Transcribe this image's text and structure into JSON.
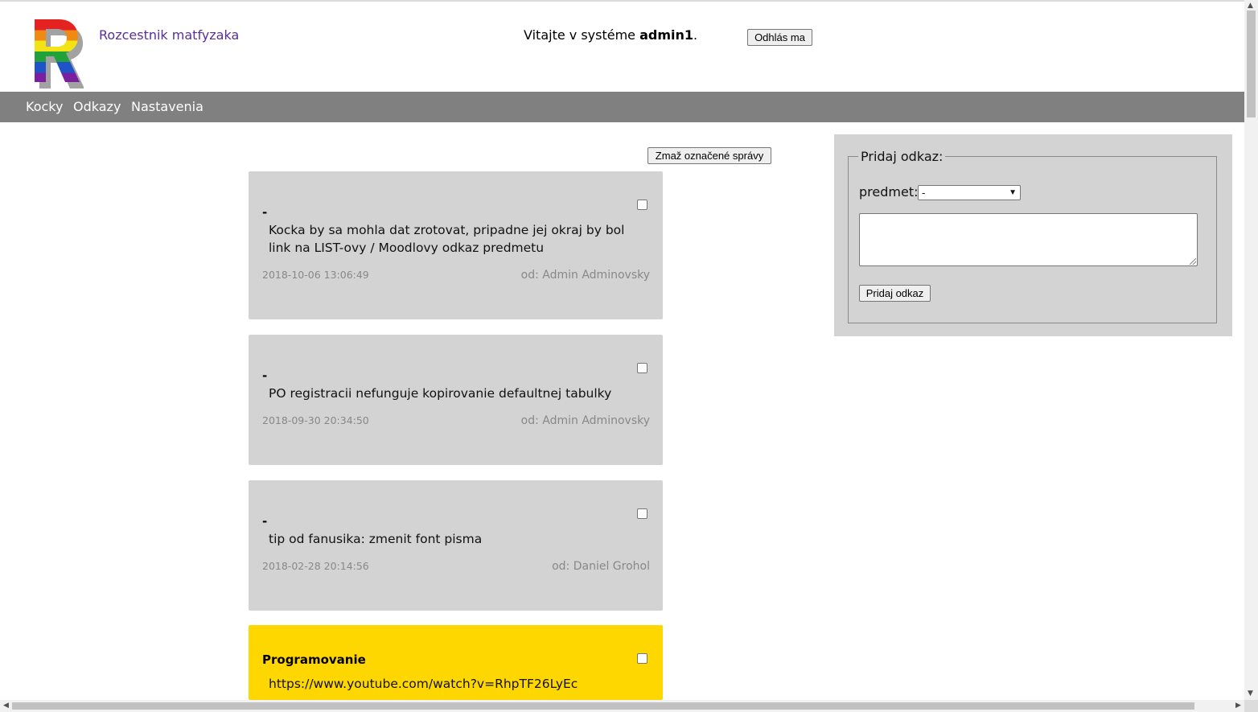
{
  "header": {
    "site_name": "Rozcestnik matfyzaka",
    "welcome_prefix": "Vitajte v systéme ",
    "username": "admin1",
    "welcome_suffix": ".",
    "logout_label": "Odhlás ma",
    "logo_letter": "R"
  },
  "nav": {
    "items": [
      {
        "label": "Kocky"
      },
      {
        "label": "Odkazy"
      },
      {
        "label": "Nastavenia"
      }
    ]
  },
  "main": {
    "delete_label": "Zmaž označené správy",
    "messages": [
      {
        "title": "-",
        "text": "Kocka by sa mohla dat zrotovat, pripadne jej okraj by bol link na LIST-ovy / Moodlovy odkaz predmetu",
        "date": "2018-10-06 13:06:49",
        "author": "od: Admin Adminovsky",
        "checked": false
      },
      {
        "title": "-",
        "text": "PO registracii nefunguje kopirovanie defaultnej tabulky",
        "date": "2018-09-30 20:34:50",
        "author": "od: Admin Adminovsky",
        "checked": false
      },
      {
        "title": "-",
        "text": "tip od fanusika: zmenit font pisma",
        "date": "2018-02-28 20:14:56",
        "author": "od: Daniel Grohol",
        "checked": false
      },
      {
        "title": "Programovanie",
        "text": "https://www.youtube.com/watch?v=RhpTF26LyEc",
        "checked": false,
        "color": "#ffd700"
      }
    ]
  },
  "side": {
    "legend": "Pridaj odkaz:",
    "subject_label": "predmet:",
    "subject_selected": "-",
    "link_value": "",
    "add_label": "Pridaj odkaz"
  },
  "colors": {
    "nav_bg": "#808080",
    "card_bg": "#d3d3d3",
    "card_highlight": "#ffd700",
    "site_name": "#5a2f96"
  }
}
